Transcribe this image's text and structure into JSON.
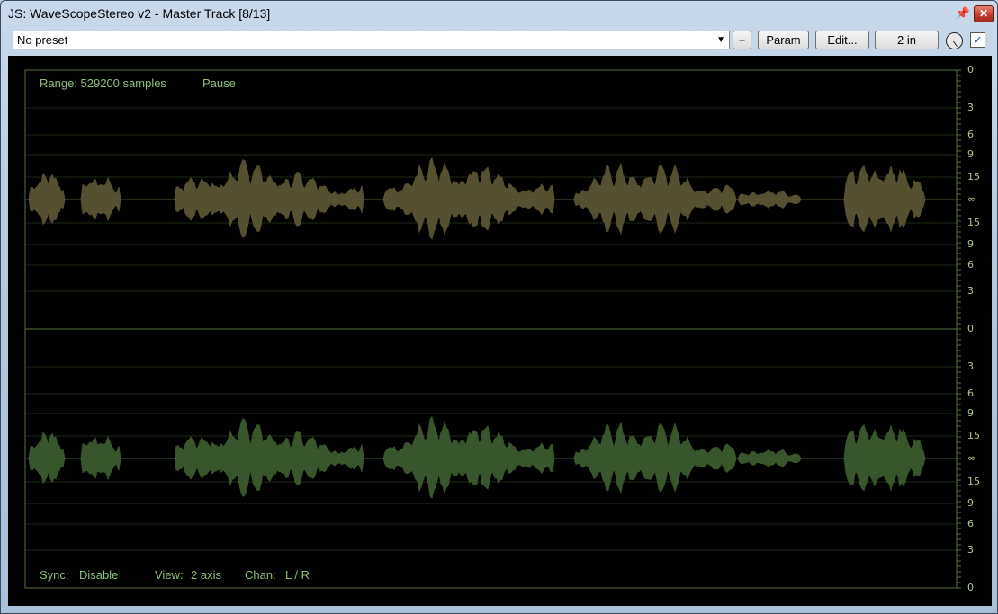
{
  "window": {
    "title": "JS: WaveScopeStereo v2 - Master Track [8/13]",
    "pin_icon": "pin-icon",
    "close_icon": "close-icon",
    "close_glyph": "✕"
  },
  "toolbar": {
    "preset_value": "No preset",
    "add_label": "+",
    "param_label": "Param",
    "edit_label": "Edit...",
    "io_label": "2 in",
    "bypass_checked": true,
    "check_glyph": "✓"
  },
  "scope": {
    "range_text": "Range: 529200 samples",
    "pause_text": "Pause",
    "sync_label": "Sync:",
    "sync_value": "Disable",
    "view_label": "View:",
    "view_value": "2 axis",
    "chan_label": "Chan:",
    "chan_value": "L / R",
    "db_labels": [
      "0",
      "3",
      "6",
      "9",
      "15",
      "∞",
      "15",
      "9",
      "6",
      "3",
      "0",
      "3",
      "6",
      "9",
      "15",
      "∞",
      "15",
      "9",
      "6",
      "3",
      "0"
    ],
    "colors": {
      "left_wave": "#5a5533",
      "right_wave": "#3c5a2e",
      "grid": "#1f2a17",
      "frame": "#5a7040",
      "text": "#8fc07a"
    }
  }
}
